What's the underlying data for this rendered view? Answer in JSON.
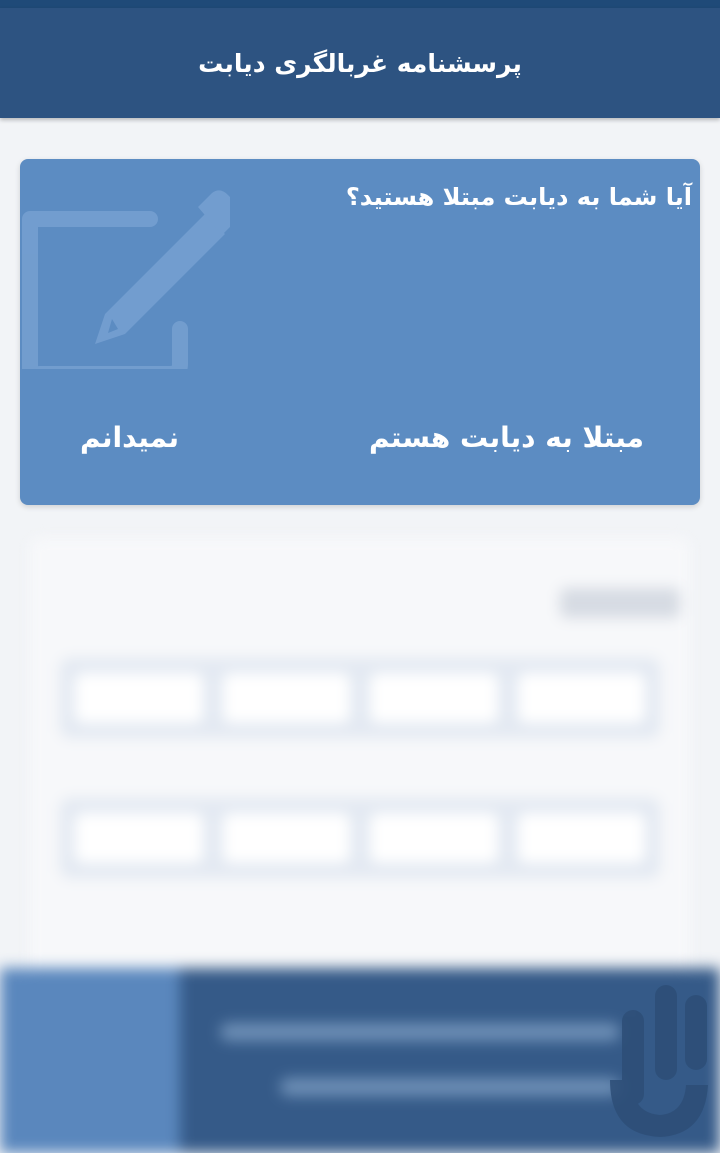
{
  "app_bar": {
    "title": "پرسشنامه غربالگری دیابت"
  },
  "dialog": {
    "question": "آیا شما به دیابت مبتلا هستید؟",
    "buttons": {
      "yes": "مبتلا به دیابت هستم",
      "unknown": "نمیدانم"
    }
  },
  "colors": {
    "app_bar": "#2d5381",
    "dialog_bg": "#5c8cc2",
    "status_bar": "#1f4a78"
  }
}
